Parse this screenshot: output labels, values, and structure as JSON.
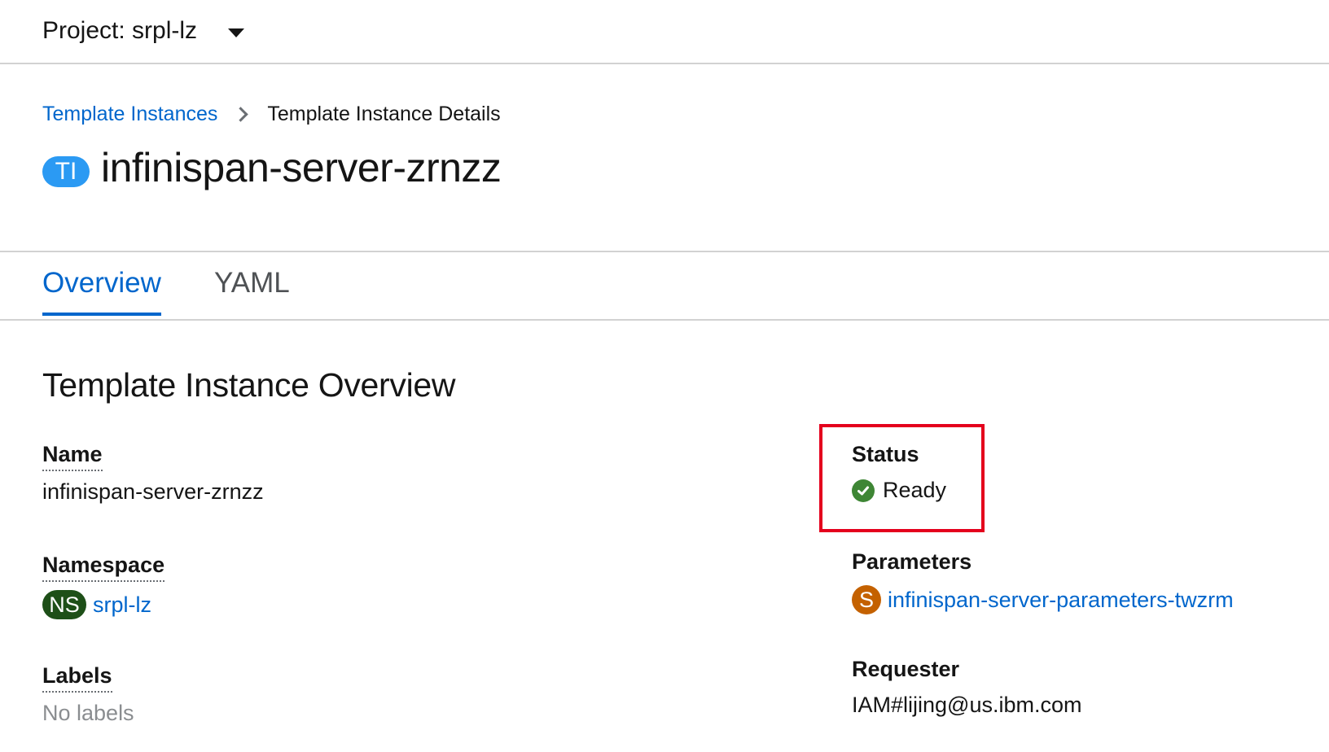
{
  "project_bar": {
    "label": "Project: srpl-lz"
  },
  "breadcrumb": {
    "parent": "Template Instances",
    "current": "Template Instance Details"
  },
  "header": {
    "badge": "TI",
    "title": "infinispan-server-zrnzz"
  },
  "tabs": [
    {
      "label": "Overview",
      "active": true
    },
    {
      "label": "YAML",
      "active": false
    }
  ],
  "overview": {
    "title": "Template Instance Overview",
    "name": {
      "label": "Name",
      "value": "infinispan-server-zrnzz"
    },
    "namespace": {
      "label": "Namespace",
      "badge": "NS",
      "value": "srpl-lz"
    },
    "labels": {
      "label": "Labels",
      "value": "No labels"
    },
    "status": {
      "label": "Status",
      "value": "Ready"
    },
    "parameters": {
      "label": "Parameters",
      "badge": "S",
      "value": "infinispan-server-parameters-twzrm"
    },
    "requester": {
      "label": "Requester",
      "value": "IAM#lijing@us.ibm.com"
    }
  },
  "colors": {
    "link": "#0066cc",
    "ti_badge": "#2b9af3",
    "ns_badge": "#1e4f18",
    "s_badge": "#c46100",
    "status_ok": "#3e8635",
    "highlight": "#e4001d"
  }
}
